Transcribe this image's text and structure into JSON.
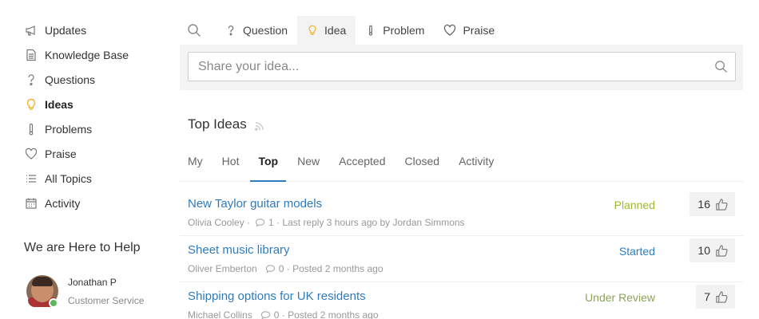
{
  "colors": {
    "accent": "#2e7bbf",
    "active_icon": "#f0b429",
    "planned": "#9bbb2e",
    "started": "#2e7bbf",
    "under_review": "#8aa35a"
  },
  "sidebar": {
    "items": [
      {
        "label": "Updates",
        "icon": "megaphone-icon"
      },
      {
        "label": "Knowledge Base",
        "icon": "document-icon"
      },
      {
        "label": "Questions",
        "icon": "question-icon"
      },
      {
        "label": "Ideas",
        "icon": "lightbulb-icon",
        "active": true
      },
      {
        "label": "Problems",
        "icon": "thermometer-icon"
      },
      {
        "label": "Praise",
        "icon": "heart-icon"
      },
      {
        "label": "All Topics",
        "icon": "list-icon"
      },
      {
        "label": "Activity",
        "icon": "calendar-icon"
      }
    ]
  },
  "help": {
    "title": "We are Here to Help",
    "agent_name": "Jonathan P",
    "agent_role": "Customer Service"
  },
  "type_tabs": {
    "question": "Question",
    "idea": "Idea",
    "problem": "Problem",
    "praise": "Praise",
    "active": "Idea"
  },
  "composer": {
    "placeholder": "Share your idea...",
    "value": ""
  },
  "section": {
    "title": "Top Ideas"
  },
  "filters": {
    "my": "My",
    "hot": "Hot",
    "top": "Top",
    "new": "New",
    "accepted": "Accepted",
    "closed": "Closed",
    "activity": "Activity",
    "active": "Top"
  },
  "ideas": [
    {
      "title": "New Taylor guitar models",
      "author": "Olivia Cooley",
      "comments": "1",
      "activity": "Last reply 3 hours ago by Jordan Simmons",
      "status": "Planned",
      "votes": "16"
    },
    {
      "title": "Sheet music library",
      "author": "Oliver Emberton",
      "comments": "0",
      "activity": "Posted 2 months ago",
      "status": "Started",
      "votes": "10"
    },
    {
      "title": "Shipping options for UK residents",
      "author": "Michael Collins",
      "comments": "0",
      "activity": "Posted 2 months ago",
      "status": "Under Review",
      "votes": "7"
    }
  ],
  "meta_separator": "·"
}
